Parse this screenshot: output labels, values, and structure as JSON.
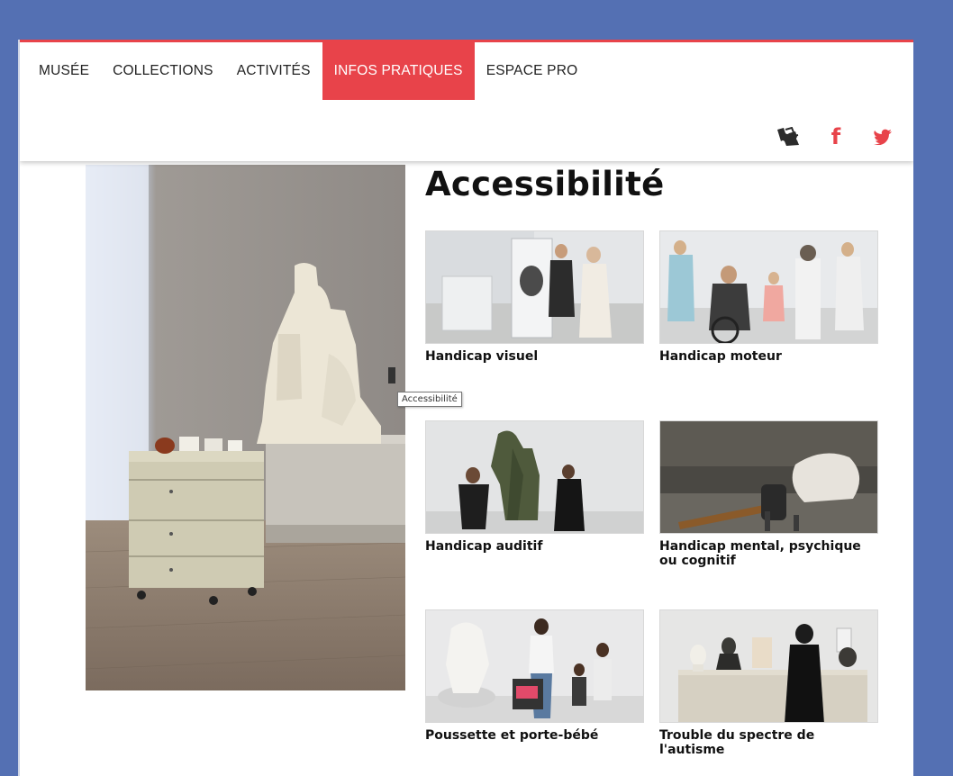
{
  "nav": {
    "items": [
      {
        "label": "MUSÉE"
      },
      {
        "label": "COLLECTIONS"
      },
      {
        "label": "ACTIVITÉS"
      },
      {
        "label": "INFOS PRATIQUES"
      },
      {
        "label": "ESPACE PRO"
      }
    ],
    "active_index": 3
  },
  "social": {
    "icons": [
      "tickets-icon",
      "facebook-icon",
      "twitter-icon"
    ],
    "facebook_glyph": "f"
  },
  "page": {
    "title": "Accessibilité",
    "tooltip": "Accessibilité"
  },
  "cards": [
    {
      "label": "Handicap visuel"
    },
    {
      "label": "Handicap moteur"
    },
    {
      "label": "Handicap auditif"
    },
    {
      "label": "Handicap mental, psychique ou cognitif"
    },
    {
      "label": "Poussette et porte-bébé"
    },
    {
      "label": "Trouble du spectre de l'autisme"
    }
  ],
  "colors": {
    "accent": "#e8434a",
    "frame": "#5470b3"
  }
}
